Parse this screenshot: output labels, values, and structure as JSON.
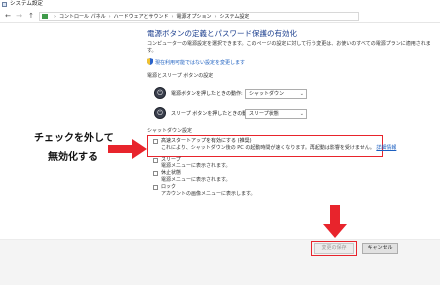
{
  "window": {
    "title": "システム設定"
  },
  "nav": {
    "back_glyph": "←",
    "forward_glyph": "→",
    "up_glyph": "↑",
    "breadcrumb": [
      "コントロール パネル",
      "ハードウェアとサウンド",
      "電源オプション",
      "システム設定"
    ],
    "separator": "›"
  },
  "page": {
    "title": "電源ボタンの定義とパスワード保護の有効化",
    "description": "コンピューターの電源設定を選択できます。このページの設定に対して行う変更は、お使いのすべての電源プランに適用されます。",
    "unavailable_link": "現在利用可能ではない設定を変更します"
  },
  "power_section": {
    "title": "電源とスリープ ボタンの設定",
    "power_label": "電源ボタンを押したときの動作:",
    "power_value": "シャットダウン",
    "sleep_label": "スリープ ボタンを押したときの動作:",
    "sleep_value": "スリープ状態"
  },
  "shutdown_section": {
    "title": "シャットダウン設定",
    "fast_startup_label": "高速スタートアップを有効にする (推奨)",
    "fast_startup_desc": "これにより、シャットダウン後の PC の起動時間が速くなります。再起動は影響を受けません。",
    "more_info": "詳細情報",
    "sleep_label": "スリープ",
    "sleep_desc": "電源メニューに表示されます。",
    "hibernate_label": "休止状態",
    "hibernate_desc": "電源メニューに表示されます。",
    "lock_label": "ロック",
    "lock_desc": "アカウントの画像メニューに表示します。"
  },
  "annotation": {
    "line1": "チェックを外して",
    "line2": "無効化する",
    "color": "#e8242c"
  },
  "footer": {
    "save_label": "変更の保存",
    "cancel_label": "キャンセル"
  }
}
